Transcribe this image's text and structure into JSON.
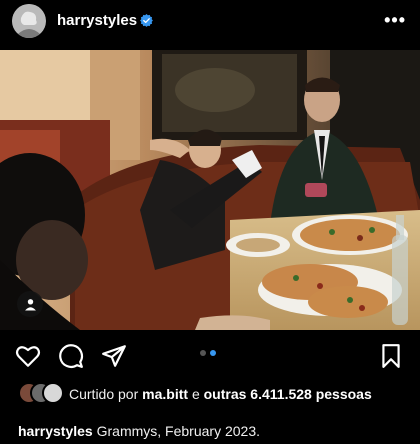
{
  "post": {
    "username": "harrystyles",
    "verified": true,
    "more_icon": "more-horizontal-icon"
  },
  "likes": {
    "prefix": "Curtido por",
    "first_user": "ma.bitt",
    "connector": "e",
    "others": "outras 6.411.528",
    "suffix": "pessoas"
  },
  "caption": {
    "username": "harrystyles",
    "text": "Grammys, February 2023."
  },
  "carousel": {
    "count": 2,
    "active_index": 1
  },
  "icons": [
    "heart-icon",
    "comment-icon",
    "share-icon",
    "bookmark-icon",
    "user-tag-icon",
    "verified-badge-icon"
  ],
  "colors": {
    "verified": "#3797f0",
    "active_dot": "#3797f0",
    "background": "#000000"
  }
}
